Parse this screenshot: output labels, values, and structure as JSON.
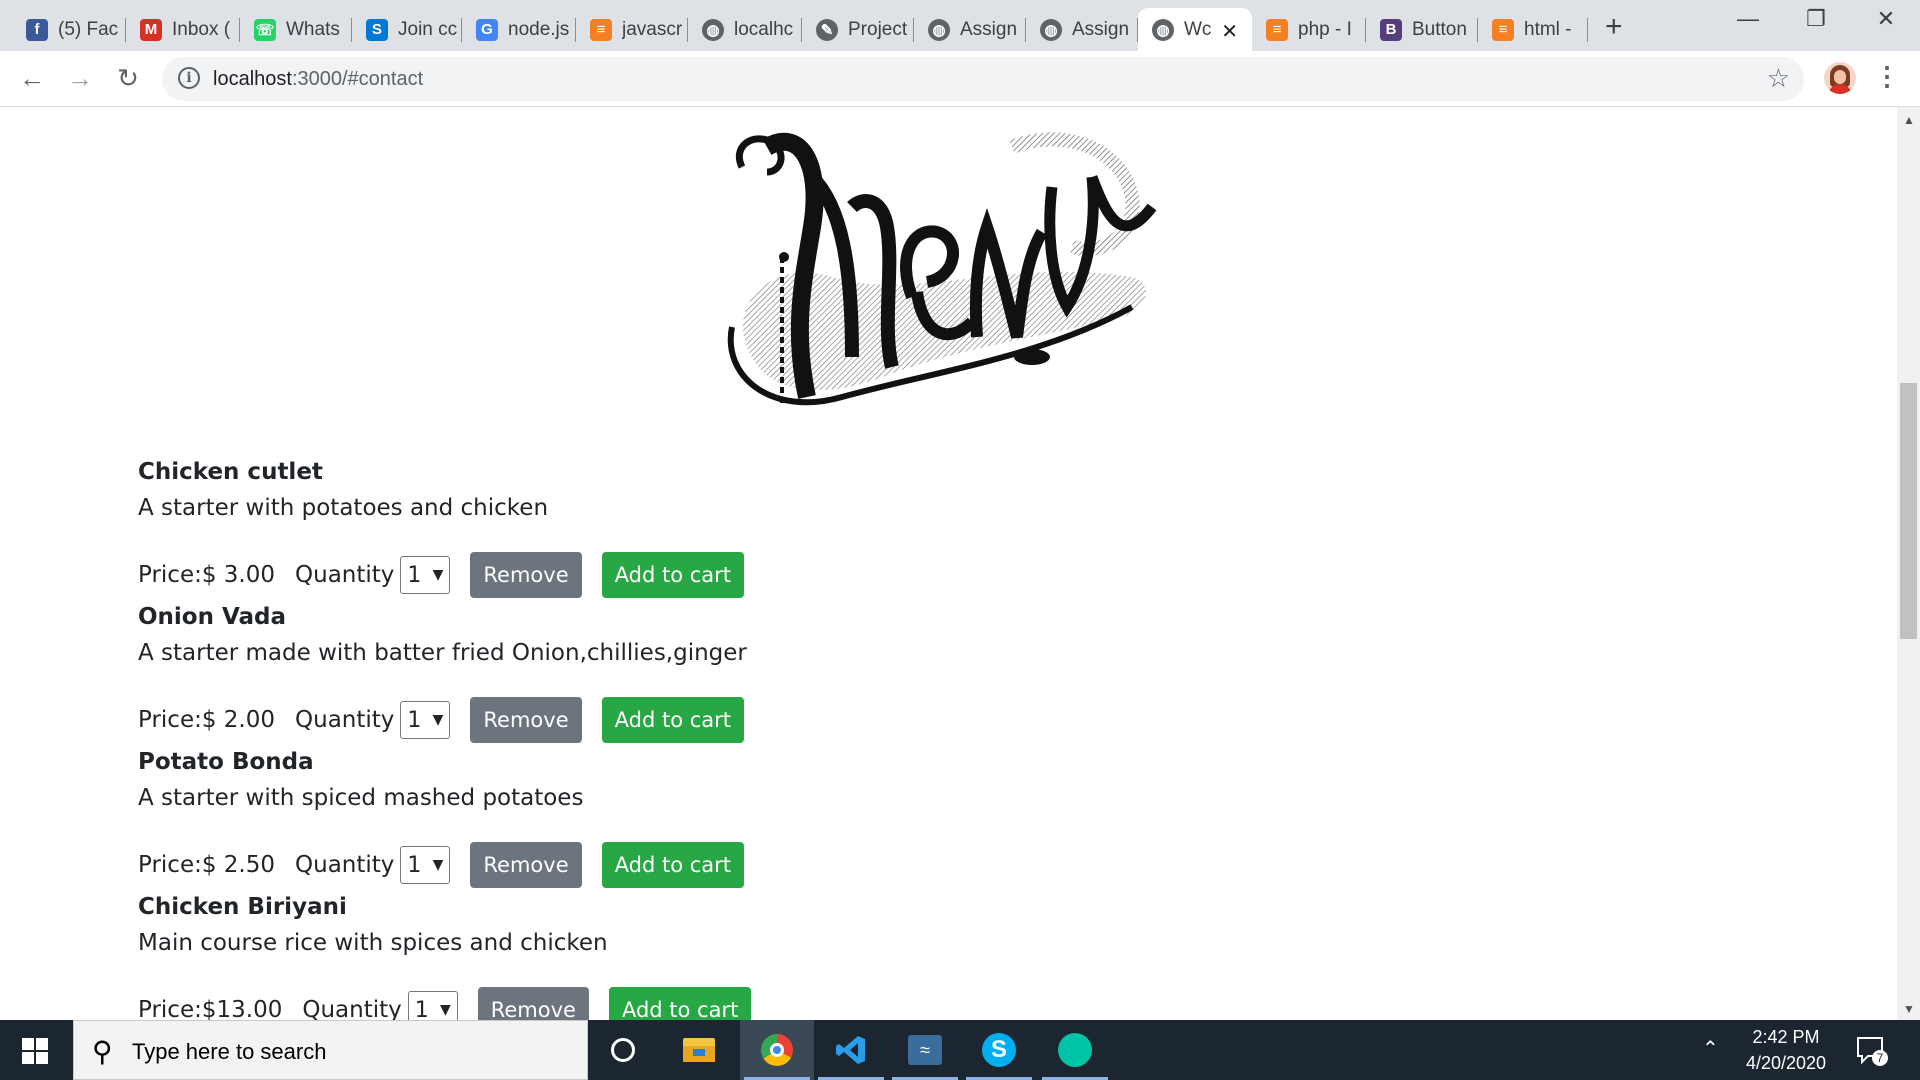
{
  "browser": {
    "tabs": [
      {
        "title": "(5) Fac",
        "icon": "facebook-icon",
        "color": "#3b5998"
      },
      {
        "title": "Inbox (",
        "icon": "gmail-icon",
        "color": "#d93025"
      },
      {
        "title": "Whats",
        "icon": "whatsapp-icon",
        "color": "#25d366"
      },
      {
        "title": "Join cc",
        "icon": "skype-icon",
        "color": "#0078d4"
      },
      {
        "title": "node.js",
        "icon": "google-icon",
        "color": "#4285f4"
      },
      {
        "title": "javascr",
        "icon": "stackoverflow-icon",
        "color": "#f48024"
      },
      {
        "title": "localhc",
        "icon": "globe-icon",
        "color": "#5f6368"
      },
      {
        "title": "Project",
        "icon": "pen-icon",
        "color": "#5f6368"
      },
      {
        "title": "Assign",
        "icon": "globe-icon",
        "color": "#5f6368"
      },
      {
        "title": "Assign",
        "icon": "globe-icon",
        "color": "#5f6368"
      },
      {
        "title": "Wc",
        "icon": "globe-icon",
        "color": "#5f6368",
        "active": true
      },
      {
        "title": "php - I",
        "icon": "stackoverflow-icon",
        "color": "#f48024"
      },
      {
        "title": "Button",
        "icon": "bootstrap-icon",
        "color": "#563d7c"
      },
      {
        "title": "html -",
        "icon": "stackoverflow-icon",
        "color": "#f48024"
      }
    ],
    "new_tab_glyph": "+",
    "close_tab_glyph": "✕",
    "url_host": "localhost",
    "url_rest": ":3000/#contact"
  },
  "menu_logo_text": "Menu",
  "items": [
    {
      "name": "Chicken cutlet",
      "description": "A starter with potatoes and chicken",
      "price": "Price:$ 3.00",
      "quantity_label": "Quantity",
      "quantity": "1",
      "remove_label": "Remove",
      "add_label": "Add to cart"
    },
    {
      "name": "Onion Vada",
      "description": "A starter made with batter fried Onion,chillies,ginger",
      "price": "Price:$ 2.00",
      "quantity_label": "Quantity",
      "quantity": "1",
      "remove_label": "Remove",
      "add_label": "Add to cart"
    },
    {
      "name": "Potato Bonda",
      "description": "A starter with spiced mashed potatoes",
      "price": "Price:$ 2.50",
      "quantity_label": "Quantity",
      "quantity": "1",
      "remove_label": "Remove",
      "add_label": "Add to cart"
    },
    {
      "name": "Chicken Biriyani",
      "description": "Main course rice with spices and chicken",
      "price": "Price:$13.00",
      "quantity_label": "Quantity",
      "quantity": "1",
      "remove_label": "Remove",
      "add_label": "Add to cart"
    }
  ],
  "taskbar": {
    "search_placeholder": "Type here to search",
    "time": "2:42 PM",
    "date": "4/20/2020",
    "notification_count": "7"
  }
}
